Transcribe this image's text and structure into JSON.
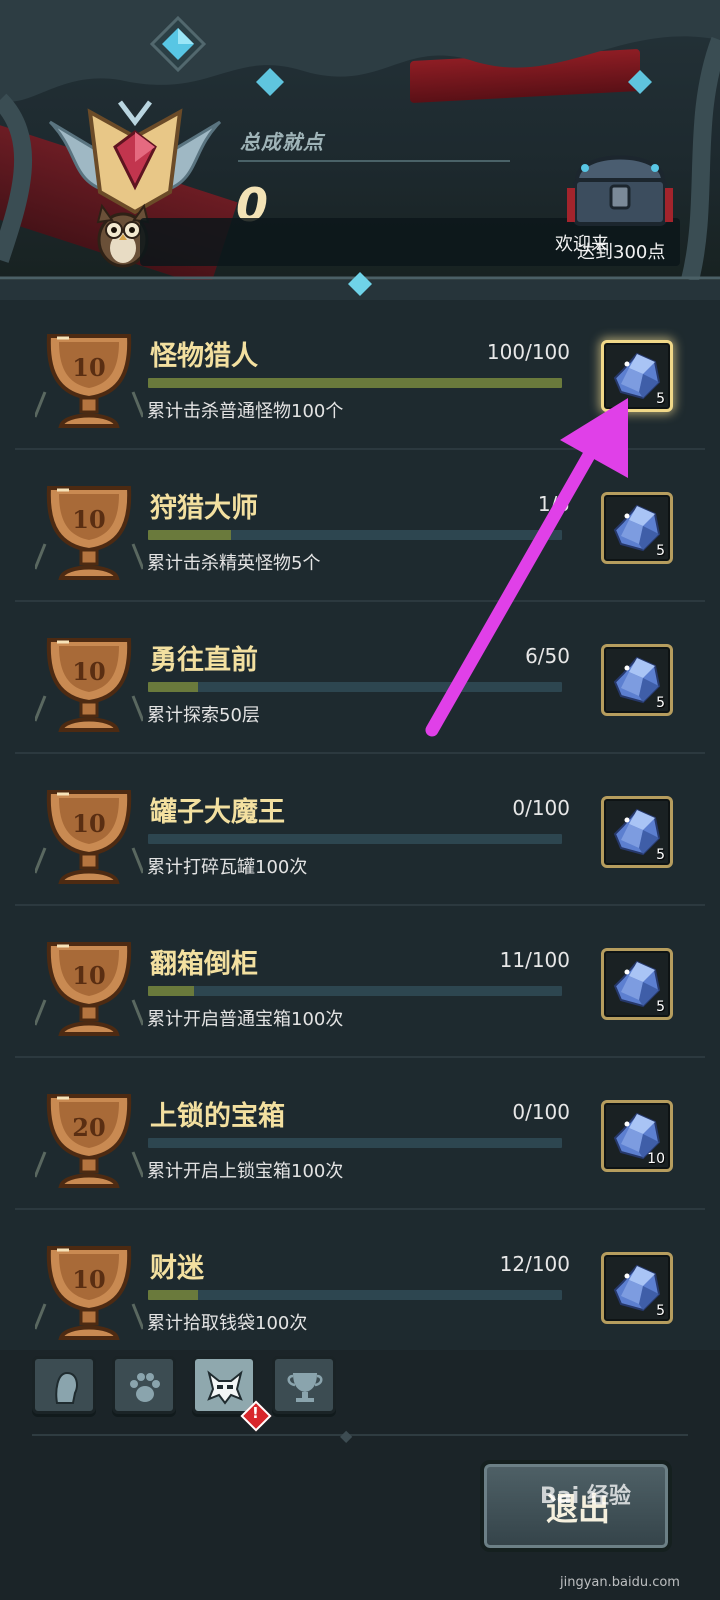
{
  "header": {
    "total_label": "总成就点",
    "total_value": "0",
    "message_part1": "欢迎来",
    "message_part2": "达到300点"
  },
  "achievements": [
    {
      "trophy_points": "10",
      "title": "怪物猎人",
      "progress": "100/100",
      "fill": 1.0,
      "description": "累计击杀普通怪物100个",
      "reward_count": "5",
      "reward_claimable": true
    },
    {
      "trophy_points": "10",
      "title": "狩猎大师",
      "progress": "1/5",
      "fill": 0.2,
      "description": "累计击杀精英怪物5个",
      "reward_count": "5",
      "reward_claimable": false
    },
    {
      "trophy_points": "10",
      "title": "勇往直前",
      "progress": "6/50",
      "fill": 0.12,
      "description": "累计探索50层",
      "reward_count": "5",
      "reward_claimable": false
    },
    {
      "trophy_points": "10",
      "title": "罐子大魔王",
      "progress": "0/100",
      "fill": 0.0,
      "description": "累计打碎瓦罐100次",
      "reward_count": "5",
      "reward_claimable": false
    },
    {
      "trophy_points": "10",
      "title": "翻箱倒柜",
      "progress": "11/100",
      "fill": 0.11,
      "description": "累计开启普通宝箱100次",
      "reward_count": "5",
      "reward_claimable": false
    },
    {
      "trophy_points": "20",
      "title": "上锁的宝箱",
      "progress": "0/100",
      "fill": 0.0,
      "description": "累计开启上锁宝箱100次",
      "reward_count": "10",
      "reward_claimable": false
    },
    {
      "trophy_points": "10",
      "title": "财迷",
      "progress": "12/100",
      "fill": 0.12,
      "description": "累计拾取钱袋100次",
      "reward_count": "5",
      "reward_claimable": false
    }
  ],
  "tabs": [
    {
      "icon": "character-head-icon",
      "active": false
    },
    {
      "icon": "paw-icon",
      "active": false
    },
    {
      "icon": "monster-icon",
      "active": true,
      "alert": "!"
    },
    {
      "icon": "trophy-icon",
      "active": false
    }
  ],
  "exit_label": "退出",
  "watermark": {
    "brand": "Bai 经验",
    "url": "jingyan.baidu.com"
  },
  "colors": {
    "title": "#f3e0a0",
    "bar_fill": "#6a7a3c",
    "bar_bg": "#2d4650",
    "frame_gold": "#b69d5e",
    "arrow": "#e040e8"
  }
}
